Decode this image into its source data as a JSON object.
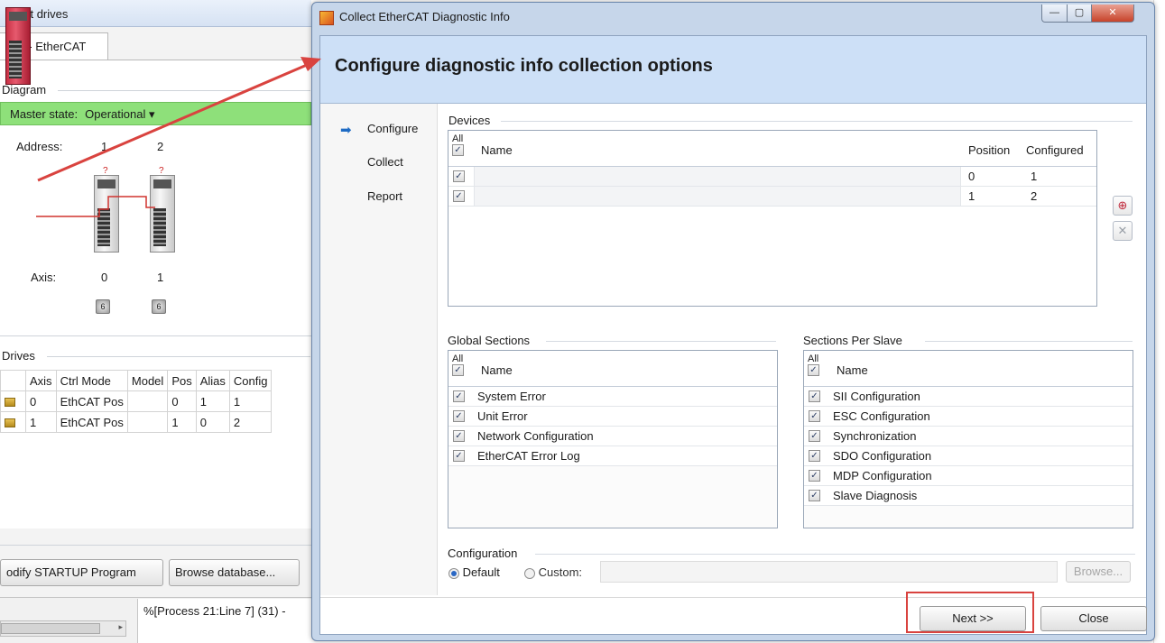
{
  "background_app": {
    "title": "ligent drives",
    "tab": "ot 0 - EtherCAT",
    "diagram_label": "Diagram",
    "master_state_label": "Master state:",
    "master_state_value": "Operational ▾",
    "address_label": "Address:",
    "address_values": [
      "1",
      "2"
    ],
    "axis_label": "Axis:",
    "axis_values": [
      "0",
      "1"
    ],
    "knob_glyph": "6",
    "drive_question_mark": "?",
    "drives_label": "Drives",
    "drives_table": {
      "columns": [
        "Axis",
        "Ctrl Mode",
        "Model",
        "Pos",
        "Alias",
        "Config"
      ],
      "rows": [
        [
          "0",
          "EthCAT Pos",
          "",
          "0",
          "1",
          "1"
        ],
        [
          "1",
          "EthCAT Pos",
          "",
          "1",
          "0",
          "2"
        ]
      ]
    },
    "modify_button": "odify STARTUP Program",
    "browse_db_button": "Browse database...",
    "status_text": "%[Process 21:Line 7] (31) -"
  },
  "dialog": {
    "title": "Collect EtherCAT Diagnostic Info",
    "header": "Configure diagnostic info collection options",
    "nav": [
      "Configure",
      "Collect",
      "Report"
    ],
    "devices": {
      "title": "Devices",
      "all_label": "All",
      "columns": [
        "Name",
        "Position",
        "Configured"
      ],
      "rows": [
        {
          "checked": true,
          "name": "",
          "position": "0",
          "configured": "1"
        },
        {
          "checked": true,
          "name": "",
          "position": "1",
          "configured": "2"
        }
      ]
    },
    "global_sections": {
      "title": "Global Sections",
      "all_label": "All",
      "column": "Name",
      "items": [
        "System Error",
        "Unit Error",
        "Network Configuration",
        "EtherCAT Error Log"
      ]
    },
    "sections_per_slave": {
      "title": "Sections Per Slave",
      "all_label": "All",
      "column": "Name",
      "items": [
        "SII Configuration",
        "ESC Configuration",
        "Synchronization",
        "SDO Configuration",
        "MDP Configuration",
        "Slave Diagnosis"
      ]
    },
    "configuration": {
      "title": "Configuration",
      "default_label": "Default",
      "custom_label": "Custom:",
      "selected": "Default",
      "custom_value": "",
      "browse_button": "Browse..."
    },
    "next_button": "Next >>",
    "close_button": "Close",
    "highlight_color": "#d9433f",
    "accent_color": "#1e6bc4"
  }
}
